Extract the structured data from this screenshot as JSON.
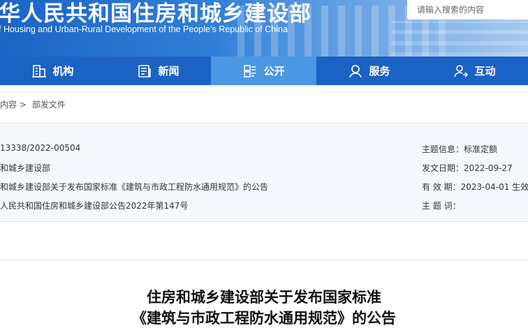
{
  "header": {
    "title": "华人民共和国住房和城乡建设部",
    "subtitle": "f Housing and Urban-Rural Development of the People’s Republic of China",
    "search_placeholder": "请输入搜索的内容"
  },
  "nav": {
    "items": [
      {
        "label": "机构",
        "icon": "building-icon"
      },
      {
        "label": "新闻",
        "icon": "newspaper-icon"
      },
      {
        "label": "公开",
        "icon": "document-icon",
        "active": true
      },
      {
        "label": "服务",
        "icon": "person-service-icon"
      },
      {
        "label": "互动",
        "icon": "interaction-icon"
      }
    ]
  },
  "breadcrumb": {
    "current_section": "内容",
    "separator": ">",
    "page": "部发文件"
  },
  "info": {
    "left": [
      "13338/2022-00504",
      "和城乡建设部",
      "和城乡建设部关于发布国家标准《建筑与市政工程防水通用规范》的公告",
      "人民共和国住房和城乡建设部公告2022年第147号"
    ],
    "right": [
      "主题信息：标准定额",
      "发文日期：2022-09-27",
      "有 效 期：2023-04-01 生效",
      "主 题 词："
    ]
  },
  "document": {
    "title_line1": "住房和城乡建设部关于发布国家标准",
    "title_line2": "《建筑与市政工程防水通用规范》的公告"
  },
  "colors": {
    "nav_bg": "#1b62c4",
    "nav_active": "#4b97e3",
    "info_bg": "#f4f8fc"
  }
}
